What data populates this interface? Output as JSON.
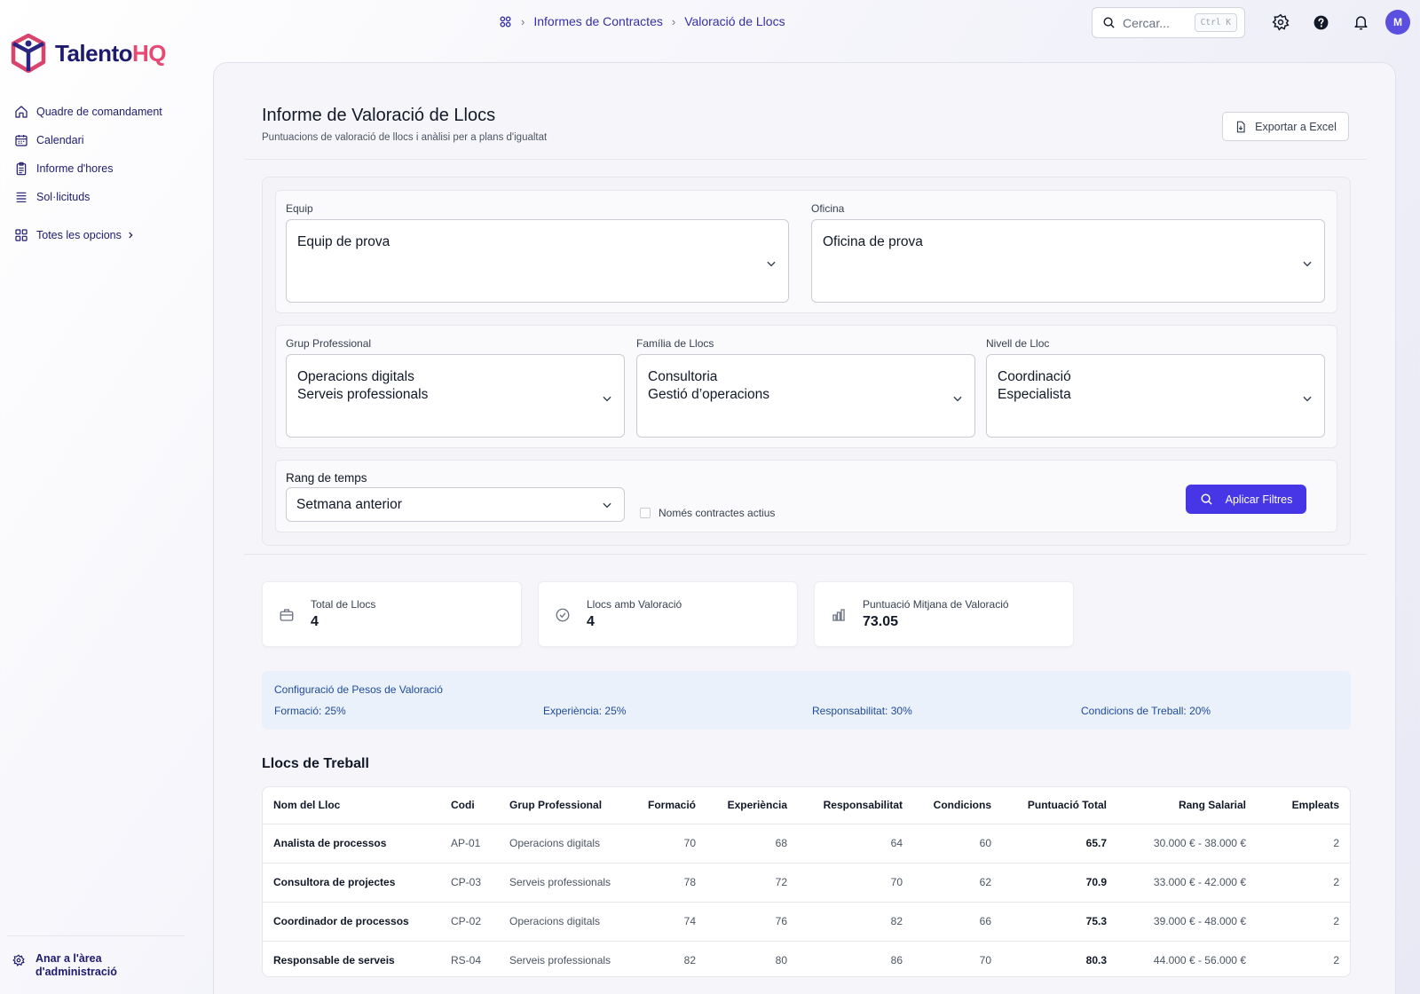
{
  "app": {
    "logo_main": "Talento",
    "logo_accent": "HQ"
  },
  "breadcrumb": {
    "items": [
      "Informes de Contractes",
      "Valoració de Llocs"
    ]
  },
  "search": {
    "placeholder": "Cercar...",
    "shortcut": "Ctrl K"
  },
  "user": {
    "avatar_initial": "M"
  },
  "sidebar": {
    "items": [
      {
        "label": "Quadre de comandament",
        "icon": "home-icon"
      },
      {
        "label": "Calendari",
        "icon": "calendar-icon"
      },
      {
        "label": "Informe d'hores",
        "icon": "clipboard-icon"
      },
      {
        "label": "Sol·licituds",
        "icon": "list-icon"
      }
    ],
    "all_options": "Totes les opcions",
    "admin_line1": "Anar a l'àrea",
    "admin_line2": "d'administració"
  },
  "header": {
    "title": "Informe de Valoració de Llocs",
    "subtitle": "Puntuacions de valoració de llocs i anàlisi per a plans d'igualtat",
    "export_label": "Exportar a Excel"
  },
  "filters": {
    "team": {
      "label": "Equip",
      "values": [
        "Equip de prova"
      ]
    },
    "office": {
      "label": "Oficina",
      "values": [
        "Oficina de prova"
      ]
    },
    "group": {
      "label": "Grup Professional",
      "values": [
        "Operacions digitals",
        "Serveis professionals"
      ]
    },
    "family": {
      "label": "Família de Llocs",
      "values": [
        "Consultoria",
        "Gestió d’operacions"
      ]
    },
    "level": {
      "label": "Nivell de Lloc",
      "values": [
        "Coordinació",
        "Especialista"
      ]
    },
    "time_range": {
      "label": "Rang de temps",
      "value": "Setmana anterior"
    },
    "active_only": {
      "label": "Només contractes actius",
      "checked": false
    },
    "apply_label": "Aplicar Filtres"
  },
  "stats": [
    {
      "label": "Total de Llocs",
      "value": "4",
      "icon": "briefcase-icon"
    },
    {
      "label": "Llocs amb Valoració",
      "value": "4",
      "icon": "check-circle-icon"
    },
    {
      "label": "Puntuació Mitjana de Valoració",
      "value": "73.05",
      "icon": "bar-chart-icon"
    }
  ],
  "weights": {
    "title": "Configuració de Pesos de Valoració",
    "items": [
      {
        "name": "Formació:",
        "value": "25%"
      },
      {
        "name": "Experiència:",
        "value": "25%"
      },
      {
        "name": "Responsabilitat:",
        "value": "30%"
      },
      {
        "name": "Condicions de Treball:",
        "value": "20%"
      }
    ]
  },
  "table": {
    "title": "Llocs de Treball",
    "columns": [
      "Nom del Lloc",
      "Codi",
      "Grup Professional",
      "Formació",
      "Experiència",
      "Responsabilitat",
      "Condicions",
      "Puntuació Total",
      "Rang Salarial",
      "Empleats"
    ],
    "rows": [
      [
        "Analista de processos",
        "AP-01",
        "Operacions digitals",
        "70",
        "68",
        "64",
        "60",
        "65.7",
        "30.000 € - 38.000 €",
        "2"
      ],
      [
        "Consultora de projectes",
        "CP-03",
        "Serveis professionals",
        "78",
        "72",
        "70",
        "62",
        "70.9",
        "33.000 € - 42.000 €",
        "2"
      ],
      [
        "Coordinador de processos",
        "CP-02",
        "Operacions digitals",
        "74",
        "76",
        "82",
        "66",
        "75.3",
        "39.000 € - 48.000 €",
        "2"
      ],
      [
        "Responsable de serveis",
        "RS-04",
        "Serveis professionals",
        "82",
        "80",
        "86",
        "70",
        "80.3",
        "44.000 € - 56.000 €",
        "2"
      ]
    ]
  },
  "colors": {
    "brand_navy": "#1e1b6e",
    "brand_pink": "#e64a72",
    "primary": "#4636e6",
    "info_bg": "#eaf1fb"
  }
}
